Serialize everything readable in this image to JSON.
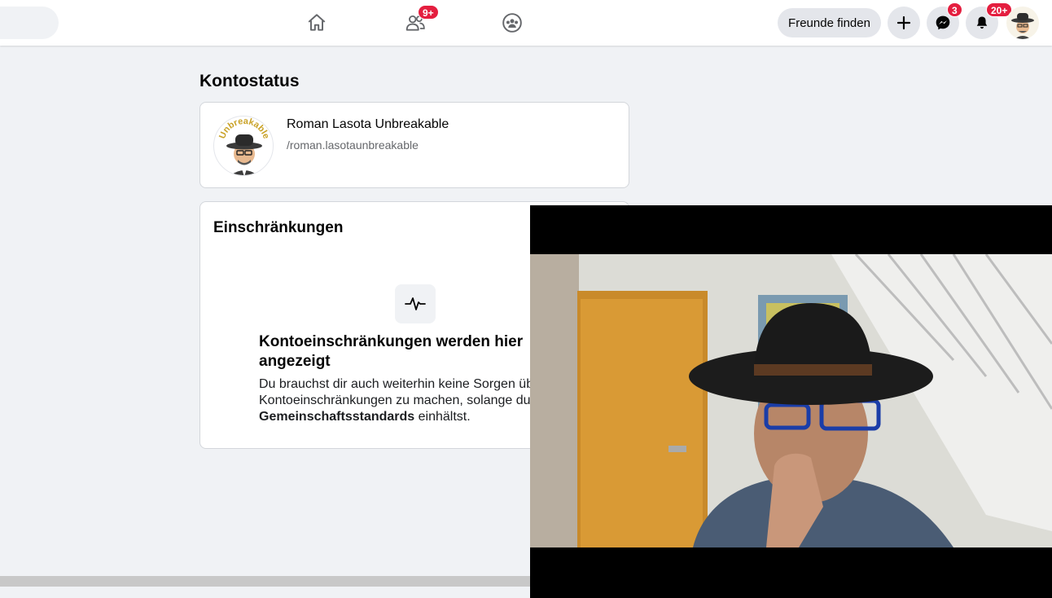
{
  "topbar": {
    "nav": [
      {
        "name": "home",
        "icon": "home-icon"
      },
      {
        "name": "friends",
        "icon": "friends-icon",
        "badge": "9+"
      },
      {
        "name": "groups",
        "icon": "groups-icon"
      }
    ],
    "find_friends_label": "Freunde finden",
    "actions": [
      {
        "name": "create",
        "icon": "plus-icon"
      },
      {
        "name": "messenger",
        "icon": "messenger-icon",
        "badge": "3"
      },
      {
        "name": "notifications",
        "icon": "bell-icon",
        "badge": "20+"
      }
    ],
    "colors": {
      "badge": "#e41e3f",
      "button_bg": "#e4e6eb"
    }
  },
  "page": {
    "title": "Kontostatus",
    "profile": {
      "name": "Roman Lasota Unbreakable",
      "handle": "/roman.lasotaunbreakable",
      "avatar_text": "Unbreakable"
    },
    "restrictions": {
      "title": "Einschränkungen",
      "icon": "pulse-icon",
      "empty_heading": "Kontoeinschränkungen werden hier angezeigt",
      "empty_text_before": "Du brauchst dir auch weiterhin keine Sorgen über Kontoeinschränkungen zu machen, solange du unsere ",
      "empty_text_bold": "Gemeinschaftsstandards",
      "empty_text_after": " einhältst."
    }
  },
  "webcam": {
    "description_icon": "webcam-video"
  }
}
